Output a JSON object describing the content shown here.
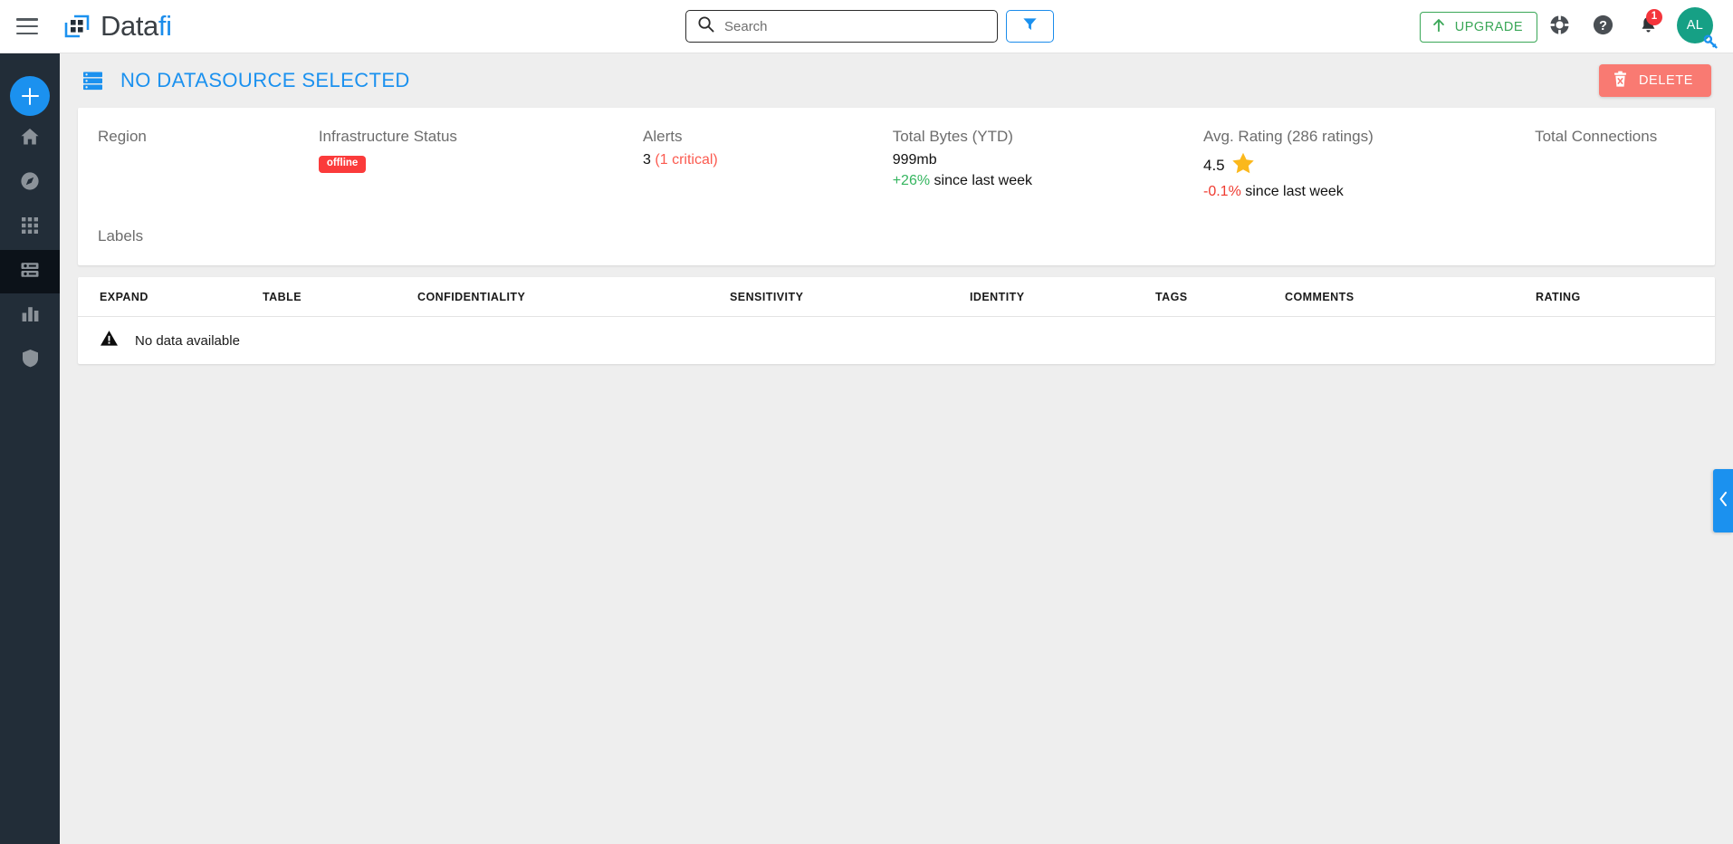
{
  "app": {
    "brand_main": "Data",
    "brand_accent": "fi",
    "accent_color": "#1b91ef"
  },
  "header": {
    "menu_icon": "hamburger-icon",
    "logo_icon": "datafi-logo-icon",
    "search": {
      "placeholder": "Search",
      "value": "",
      "icon": "search-icon"
    },
    "filter_button": {
      "icon": "filter-funnel-icon",
      "label": ""
    },
    "upgrade_button": {
      "label": "UPGRADE",
      "icon": "arrow-up-icon",
      "color": "#3aa757"
    },
    "support_icon": "lifebuoy-icon",
    "help_icon": "help-circle-icon",
    "notifications": {
      "icon": "bell-icon",
      "count": "1",
      "badge_color": "#f4353c"
    },
    "user": {
      "initials": "AL",
      "avatar_color": "#16a085",
      "badge_icon": "key-icon"
    }
  },
  "sidebar": {
    "add_button": {
      "icon": "plus-icon",
      "label": ""
    },
    "items": [
      {
        "icon": "home-icon",
        "name": "home",
        "active": false
      },
      {
        "icon": "compass-icon",
        "name": "explore",
        "active": false
      },
      {
        "icon": "grid-apps-icon",
        "name": "apps",
        "active": false
      },
      {
        "icon": "database-icon",
        "name": "datasources",
        "active": true
      },
      {
        "icon": "bar-chart-icon",
        "name": "analytics",
        "active": false
      },
      {
        "icon": "shield-icon",
        "name": "security",
        "active": false
      }
    ]
  },
  "page": {
    "title": "NO DATASOURCE SELECTED",
    "title_icon": "database-list-icon",
    "delete_button": {
      "label": "DELETE",
      "icon": "trash-x-icon",
      "color": "#f97a72"
    }
  },
  "metrics": {
    "region": {
      "label": "Region",
      "value": ""
    },
    "infrastructure_status": {
      "label": "Infrastructure Status",
      "badge": "offline",
      "badge_color": "#fb3b3b"
    },
    "alerts": {
      "label": "Alerts",
      "count": "3",
      "critical": "(1 critical)"
    },
    "total_bytes": {
      "label": "Total Bytes (YTD)",
      "value": "999mb",
      "delta": "+26%",
      "delta_suffix": "since last week",
      "delta_color": "#35b55f"
    },
    "avg_rating": {
      "label": "Avg. Rating (286 ratings)",
      "value": "4.5",
      "star_icon": "star-icon",
      "delta": "-0.1%",
      "delta_suffix": "since last week",
      "delta_color": "#ef3b30"
    },
    "total_connections": {
      "label": "Total Connections",
      "value": ""
    },
    "labels": {
      "label": "Labels",
      "value": ""
    }
  },
  "table": {
    "columns": [
      "EXPAND",
      "TABLE",
      "CONFIDENTIALITY",
      "SENSITIVITY",
      "IDENTITY",
      "TAGS",
      "COMMENTS",
      "RATING"
    ],
    "empty_state": {
      "icon": "warning-triangle-icon",
      "text": "No data available"
    },
    "rows": []
  },
  "collapse_panel": {
    "icon": "chevron-left-icon",
    "label": ""
  }
}
